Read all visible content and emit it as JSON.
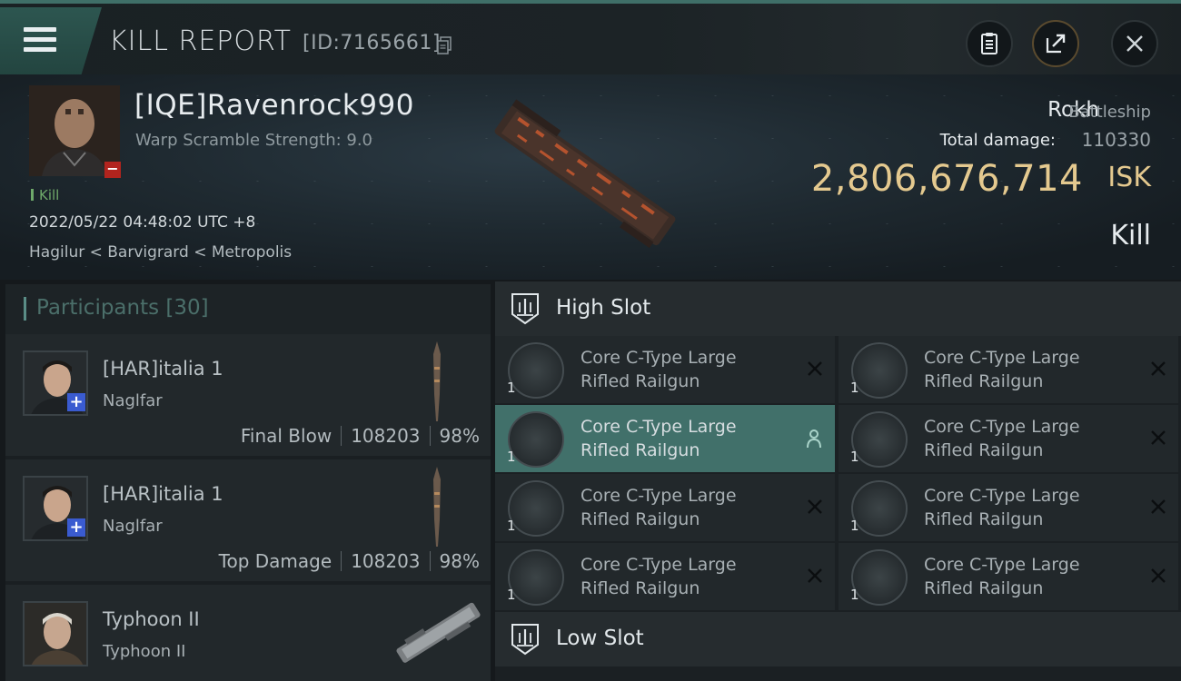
{
  "header": {
    "title": "KILL REPORT",
    "report_id": "[ID:7165661]"
  },
  "victim": {
    "name": "[IQE]Ravenrock990",
    "warp_scramble": "Warp Scramble Strength: 9.0",
    "tag": "Kill",
    "datetime": "2022/05/22 04:48:02 UTC +8",
    "location": "Hagilur < Barvigrard < Metropolis",
    "ship_name": "Rokh",
    "ship_class": "Battleship",
    "total_damage_label": "Total damage:",
    "total_damage_value": "110330",
    "isk_value": "2,806,676,714",
    "isk_unit": "ISK",
    "result": "Kill"
  },
  "participants": {
    "title": "Participants [30]",
    "rows": [
      {
        "name": "[HAR]italia 1",
        "ship": "Naglfar",
        "role": "Final Blow",
        "damage": "108203",
        "percent": "98%"
      },
      {
        "name": "[HAR]italia 1",
        "ship": "Naglfar",
        "role": "Top Damage",
        "damage": "108203",
        "percent": "98%"
      },
      {
        "name": "Typhoon II",
        "ship": "Typhoon II",
        "role": "",
        "damage": "",
        "percent": ""
      }
    ]
  },
  "slots": {
    "high_title": "High Slot",
    "low_title": "Low Slot",
    "high_modules": [
      {
        "line1": "Core C-Type Large",
        "line2": "Rifled Railgun",
        "qty": "1",
        "status": "destroyed"
      },
      {
        "line1": "Core C-Type Large",
        "line2": "Rifled Railgun",
        "qty": "1",
        "status": "destroyed"
      },
      {
        "line1": "Core C-Type Large",
        "line2": "Rifled Railgun",
        "qty": "1",
        "status": "dropped"
      },
      {
        "line1": "Core C-Type Large",
        "line2": "Rifled Railgun",
        "qty": "1",
        "status": "destroyed"
      },
      {
        "line1": "Core C-Type Large",
        "line2": "Rifled Railgun",
        "qty": "1",
        "status": "destroyed"
      },
      {
        "line1": "Core C-Type Large",
        "line2": "Rifled Railgun",
        "qty": "1",
        "status": "destroyed"
      },
      {
        "line1": "Core C-Type Large",
        "line2": "Rifled Railgun",
        "qty": "1",
        "status": "destroyed"
      },
      {
        "line1": "Core C-Type Large",
        "line2": "Rifled Railgun",
        "qty": "1",
        "status": "destroyed"
      }
    ]
  },
  "icons": {
    "menu": "hamburger-menu-icon",
    "copy": "copy-icon",
    "clipboard": "clipboard-icon",
    "share": "share-icon",
    "close": "close-icon",
    "high_slot": "high-slot-icon",
    "low_slot": "low-slot-icon",
    "destroyed": "x-icon",
    "dropped": "person-icon"
  },
  "colors": {
    "accent": "#41706a",
    "isk": "#e4c98f",
    "kill_tag": "#6fa96a",
    "minus_badge": "#b2241e",
    "plus_badge": "#3a5bd0"
  }
}
